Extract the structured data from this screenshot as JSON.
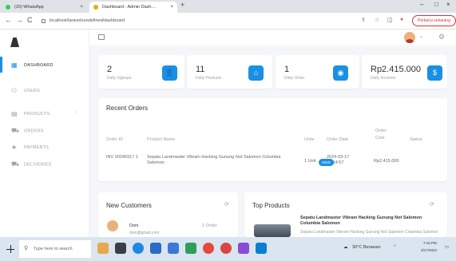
{
  "browser": {
    "tabs": [
      {
        "label": "(20) WhatsApp",
        "favicon": "#25d366"
      },
      {
        "label": "Dashboard - Admin Dash…",
        "favicon": "#e0b000"
      }
    ],
    "url": "localhost/laraveloundefined/dashboard",
    "update_label": "Perbarui sekarang"
  },
  "sidebar": {
    "items": [
      {
        "label": "DASHBOARD",
        "icon": "grid-icon"
      },
      {
        "label": "USERS",
        "icon": "users-icon"
      },
      {
        "label": "PRODUCTS",
        "icon": "box-icon"
      },
      {
        "label": "ORDERS",
        "icon": "cart-icon"
      },
      {
        "label": "PAYMENTS",
        "icon": "star-icon"
      },
      {
        "label": "DELIVERIES",
        "icon": "truck-icon"
      }
    ]
  },
  "stats": [
    {
      "value": "2",
      "label": "Daily Signups",
      "icon": "person-icon"
    },
    {
      "value": "11",
      "label": "Daily Products",
      "icon": "tag-icon"
    },
    {
      "value": "1",
      "label": "Daily Order",
      "icon": "order-icon"
    },
    {
      "value": "Rp2.415.000",
      "label": "Daily Incomes",
      "icon": "money-icon"
    }
  ],
  "recent_orders": {
    "title": "Recent Orders",
    "columns": [
      "Order ID",
      "Product Name",
      "Units",
      "Order Date",
      "Order Cost",
      "Status"
    ],
    "rows": [
      {
        "id": "INV 20240317 1",
        "product": "Sepatu Landmaster Vibram Hacking Gunung Not Salomon Columbia Salomon",
        "units": "1 Unit",
        "date": "2024-03-17 10:14:57",
        "cost": "Rp2.415.000",
        "status": "NEW"
      }
    ]
  },
  "new_customers": {
    "title": "New Customers",
    "items": [
      {
        "name": "Doni",
        "email": "doni@gmail.com",
        "orders": "1 Order"
      }
    ]
  },
  "top_products": {
    "title": "Top Products",
    "items": [
      {
        "name": "Sepatu Landmaster Vibram Hacking Gunung Not Salomon Columbia Salomon",
        "desc": "Sepatu Landmaster Vibram Hacking Gunung Not Salomon Columbia Salomon"
      }
    ]
  },
  "taskbar": {
    "search_placeholder": "Type here to search",
    "weather": "30°C Berawan",
    "time": "7:43 PM",
    "date": "3/17/2024"
  },
  "colors": {
    "accent": "#1a8fe3"
  }
}
